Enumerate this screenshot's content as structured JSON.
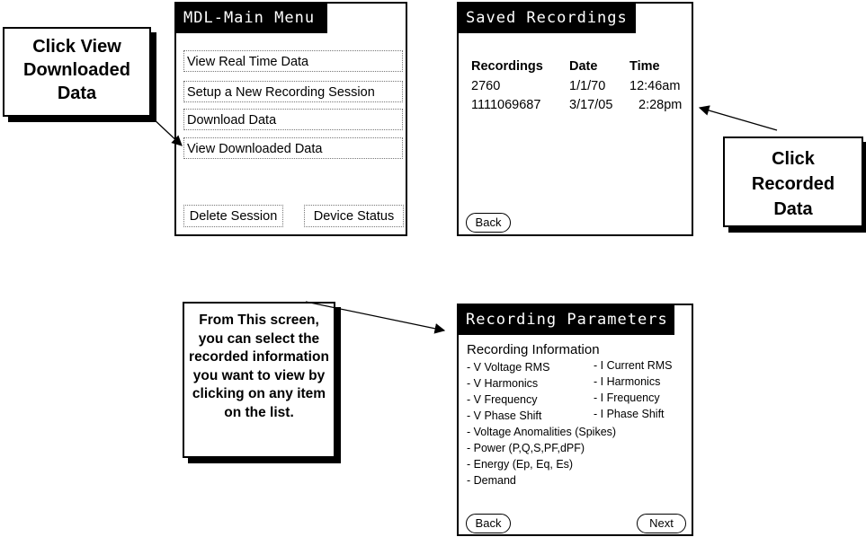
{
  "main_menu": {
    "title": "MDL-Main Menu",
    "items": [
      "View Real Time Data",
      "Setup a New Recording Session",
      "Download Data",
      "View Downloaded Data"
    ],
    "delete_session": "Delete Session",
    "device_status": "Device Status"
  },
  "saved_recordings": {
    "title": "Saved Recordings",
    "headers": {
      "recordings": "Recordings",
      "date": "Date",
      "time": "Time"
    },
    "rows": [
      {
        "recording": "2760",
        "date": "1/1/70",
        "time": "12:46am"
      },
      {
        "recording": "1111069687",
        "date": "3/17/05",
        "time": "2:28pm"
      }
    ],
    "back": "Back"
  },
  "recording_parameters": {
    "title": "Recording Parameters",
    "section": "Recording Information",
    "left_items": [
      "- V Voltage RMS",
      "- V Harmonics",
      "- V Frequency",
      "- V Phase Shift",
      "- Voltage Anomalities (Spikes)",
      "- Power (P,Q,S,PF,dPF)",
      "- Energy (Ep, Eq, Es)",
      "- Demand"
    ],
    "right_items": [
      "- I Current RMS",
      "- I Harmonics",
      "- I Frequency",
      "- I Phase Shift"
    ],
    "back": "Back",
    "next": "Next"
  },
  "callouts": {
    "view_downloaded": [
      "Click View",
      "Downloaded",
      "Data"
    ],
    "recorded_data": [
      "Click",
      "Recorded",
      "Data"
    ],
    "select_info": [
      "From This screen,",
      "you can select the",
      "recorded information",
      "you want to view by",
      "clicking on any item",
      "on the list."
    ]
  }
}
